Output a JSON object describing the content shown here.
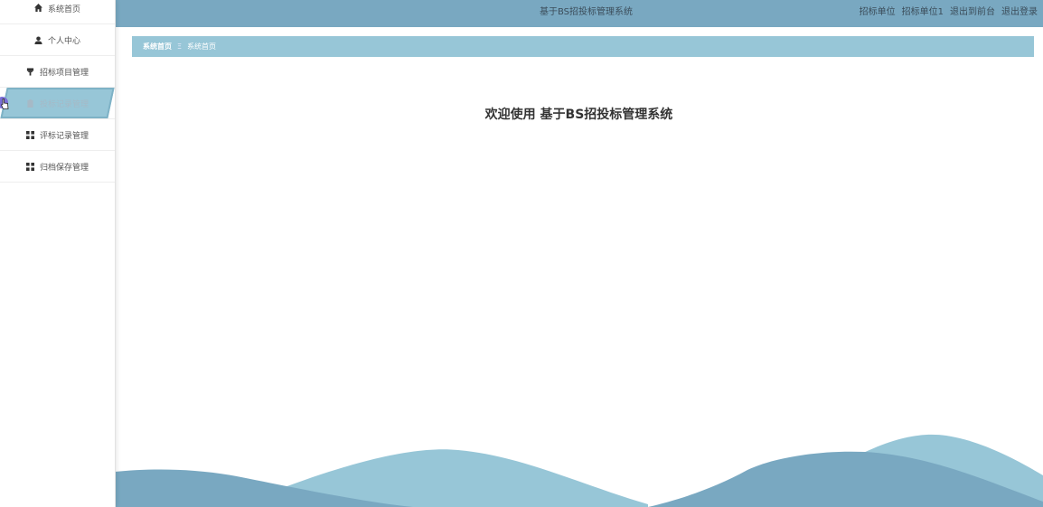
{
  "sidebar": {
    "items": [
      {
        "label": "系统首页",
        "icon": "home-icon"
      },
      {
        "label": "个人中心",
        "icon": "user-icon"
      },
      {
        "label": "招标项目管理",
        "icon": "gavel-icon"
      },
      {
        "label": "投标记录管理",
        "icon": "clipboard-icon",
        "active": true
      },
      {
        "label": "评标记录管理",
        "icon": "grid-icon"
      },
      {
        "label": "归档保存管理",
        "icon": "grid-icon"
      }
    ]
  },
  "header": {
    "title": "基于BS招投标管理系统",
    "user_role": "招标单位",
    "user_name": "招标单位1",
    "front_link": "退出到前台",
    "logout_link": "退出登录"
  },
  "breadcrumb": {
    "home": "系统首页",
    "separator": "Ξ",
    "current": "系统首页"
  },
  "main": {
    "welcome": "欢迎使用 基于BS招投标管理系统"
  },
  "colors": {
    "header_bg": "#79a8c1",
    "breadcrumb_bg": "#97c6d7",
    "active_menu": "#97c6d7",
    "wave_light": "#97c6d7",
    "wave_dark": "#79a8c1"
  }
}
